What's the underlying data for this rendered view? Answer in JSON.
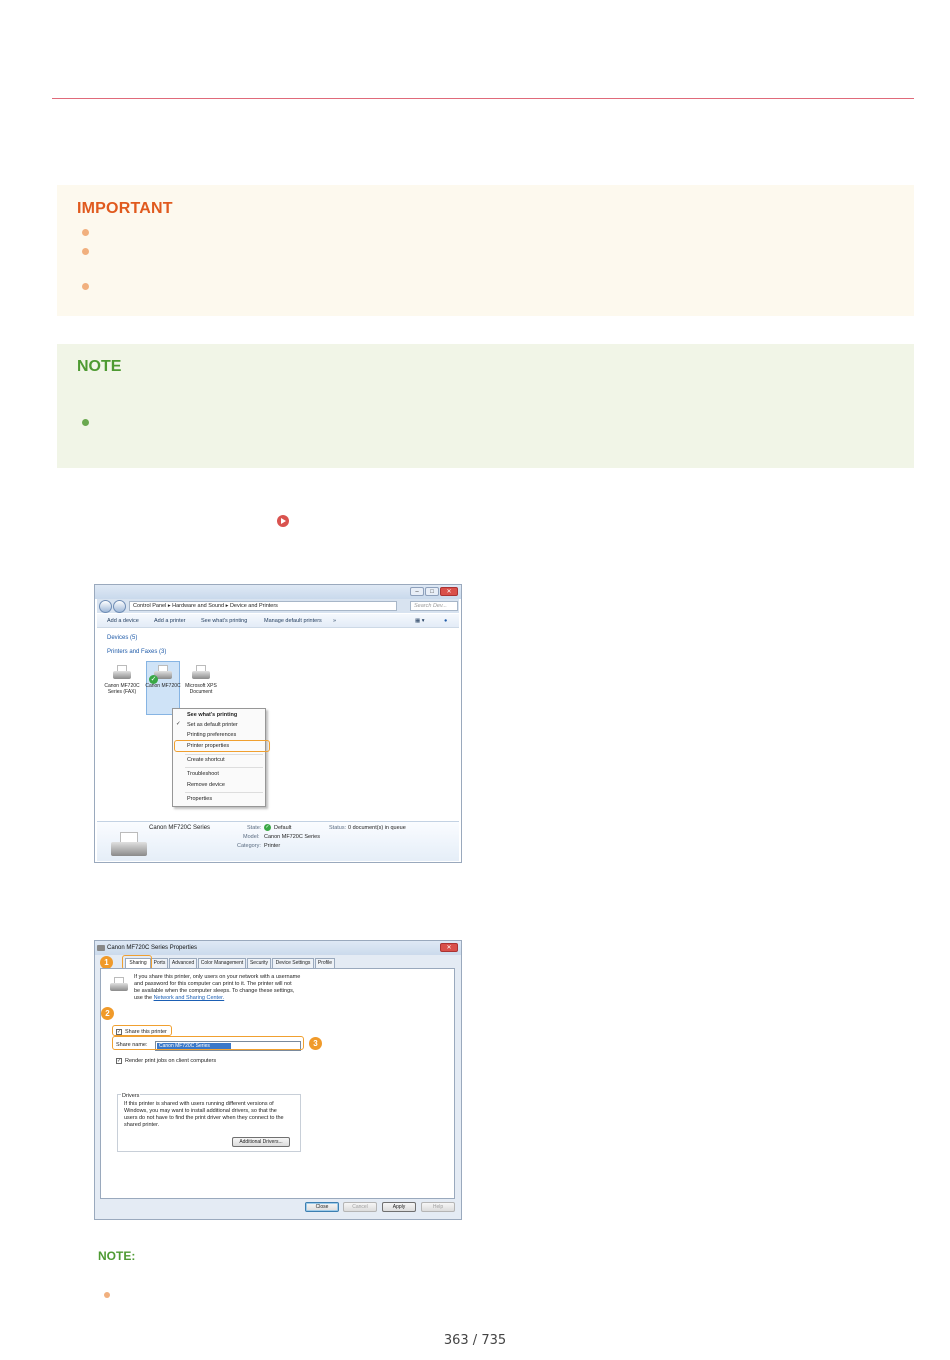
{
  "important": {
    "heading": "IMPORTANT",
    "color": "#e05a1e"
  },
  "note": {
    "heading": "NOTE",
    "color": "#4e9a32"
  },
  "screenshot1": {
    "address_path": "Control Panel  ▸  Hardware and Sound  ▸  Device and Printers",
    "search_placeholder": "Search Dev...",
    "toolbar": {
      "add_device": "Add a device",
      "add_printer": "Add a printer",
      "see_printing": "See what's printing",
      "manage_default": "Manage default printers",
      "more": "»"
    },
    "groups": {
      "devices": "Devices (5)",
      "printers": "Printers and Faxes (3)"
    },
    "devices": [
      {
        "label": "Canon MF720C Series (FAX)"
      },
      {
        "label": "Canon MF720C"
      },
      {
        "label": "Microsoft XPS Document"
      }
    ],
    "context_menu": {
      "see_printing": "See what's printing",
      "set_default": "Set as default printer",
      "preferences": "Printing preferences",
      "printer_properties": "Printer properties",
      "create_shortcut": "Create shortcut",
      "troubleshoot": "Troubleshoot",
      "remove_device": "Remove device",
      "properties": "Properties"
    },
    "details": {
      "name": "Canon MF720C Series",
      "state_label": "State:",
      "state_value": "Default",
      "status_label": "Status:",
      "status_value": "0 document(s) in queue",
      "model_label": "Model:",
      "model_value": "Canon MF720C Series",
      "category_label": "Category:",
      "category_value": "Printer"
    }
  },
  "screenshot2": {
    "title": "Canon MF720C Series          Properties",
    "tabs": [
      "Sharing",
      "Ports",
      "Advanced",
      "Color Management",
      "Security",
      "Device Settings",
      "Profile"
    ],
    "intro_text_1": "If you share this printer, only users on your network with a username",
    "intro_text_2": "and password for this computer can print to it. The printer will not",
    "intro_text_3": "be available when the computer sleeps. To change these settings,",
    "intro_text_4": "use the",
    "intro_link": "Network and Sharing Center.",
    "share_label": "Share this printer",
    "share_name_label": "Share name:",
    "share_name_value": "Canon MF720C Series",
    "render_label": "Render print jobs on client computers",
    "drivers_heading": "Drivers",
    "drivers_text_1": "If this printer is shared with users running different versions of",
    "drivers_text_2": "Windows, you may want to install additional drivers, so that the",
    "drivers_text_3": "users do not have to find the print driver when they connect to the",
    "drivers_text_4": "shared printer.",
    "additional_drivers_btn": "Additional Drivers...",
    "buttons": {
      "close": "Close",
      "cancel": "Cancel",
      "apply": "Apply",
      "help": "Help"
    },
    "badges": [
      "1",
      "2",
      "3"
    ]
  },
  "note2": {
    "heading": "NOTE:"
  },
  "page_number": "363 / 735"
}
